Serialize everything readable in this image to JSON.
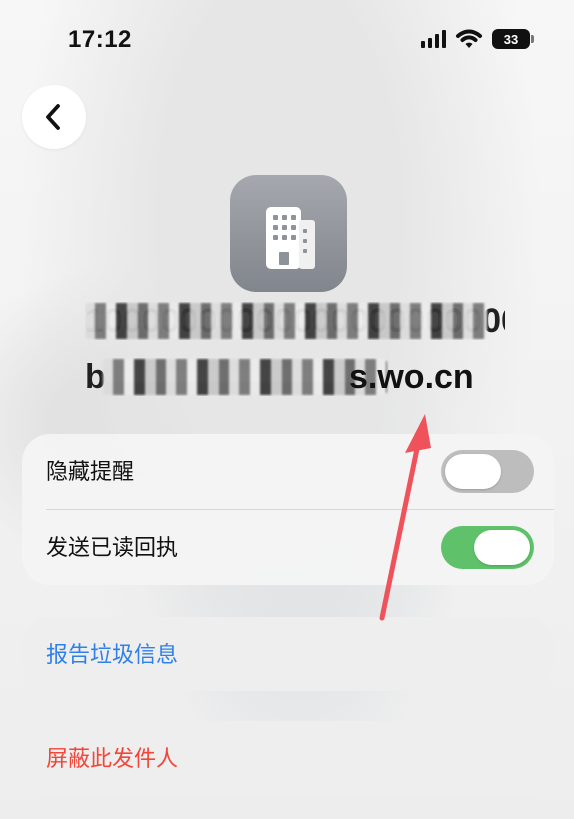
{
  "status_bar": {
    "time": "17:12",
    "battery": "33",
    "icons": [
      "signal-icon",
      "wifi-icon",
      "battery-icon"
    ]
  },
  "navigation": {
    "back_icon": "chevron-left-icon"
  },
  "sender": {
    "avatar_icon": "building-icon",
    "line_1": "100000000000000000000000",
    "line_2_prefix": "b",
    "line_2_suffix": "s.wo.cn"
  },
  "settings": {
    "hide_alerts_label": "隐藏提醒",
    "hide_alerts_state": "off",
    "send_read_receipts_label": "发送已读回执",
    "send_read_receipts_state": "on"
  },
  "actions": {
    "report_spam": "报告垃圾信息",
    "block_sender": "屏蔽此发件人"
  },
  "colors": {
    "background": "#f2f2f2",
    "card": "#f4f4f4",
    "toggle_on": "#5fc26a",
    "toggle_off": "#bdbdbd",
    "link_blue": "#2f80e8",
    "danger_red": "#f24639",
    "arrow_red": "#f0525c"
  }
}
